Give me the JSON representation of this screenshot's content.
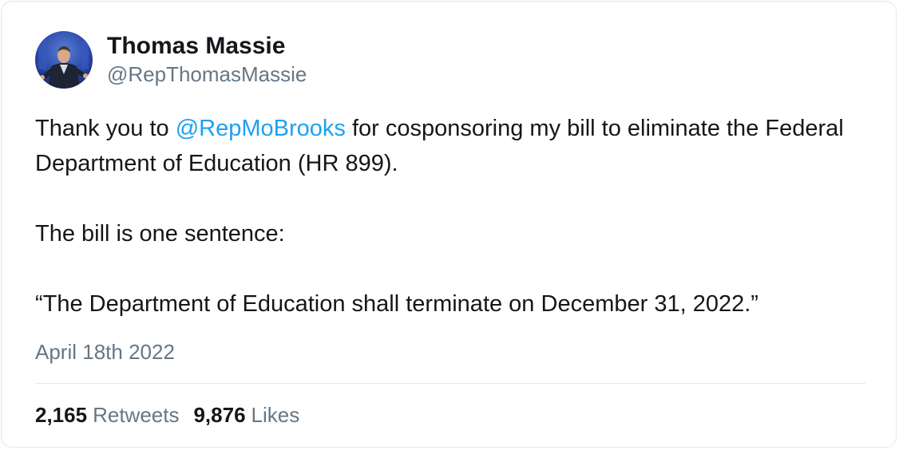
{
  "author": {
    "display_name": "Thomas Massie",
    "handle": "@RepThomasMassie",
    "avatar_icon": "profile-photo"
  },
  "tweet": {
    "text_before_mention": "Thank you to ",
    "mention": "@RepMoBrooks",
    "text_after_mention": " for cosponsoring my bill to eliminate the Federal Department of Education (HR 899).",
    "paragraph_2": "The bill is one sentence:",
    "paragraph_3": "“The Department of Education shall terminate on December 31, 2022.”",
    "date": "April 18th 2022"
  },
  "stats": {
    "retweets_count": "2,165",
    "retweets_label": "Retweets",
    "likes_count": "9,876",
    "likes_label": "Likes"
  },
  "colors": {
    "text": "#14171a",
    "secondary": "#657786",
    "link": "#1da1f2",
    "border": "#e1e8ed"
  }
}
